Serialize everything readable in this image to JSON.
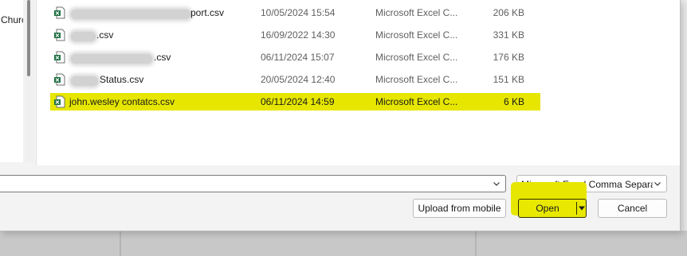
{
  "navigation": {
    "visible_label": "Churc"
  },
  "files": [
    {
      "name_visible": "port.csv",
      "date": "10/05/2024 15:54",
      "type": "Microsoft Excel C...",
      "size": "206 KB",
      "selected": false
    },
    {
      "name_visible": ".csv",
      "date": "16/09/2022 14:30",
      "type": "Microsoft Excel C...",
      "size": "331 KB",
      "selected": false
    },
    {
      "name_visible": ".csv",
      "date": "06/11/2024 15:07",
      "type": "Microsoft Excel C...",
      "size": "176 KB",
      "selected": false
    },
    {
      "name_visible": "Status.csv",
      "date": "20/05/2024 12:40",
      "type": "Microsoft Excel C...",
      "size": "151 KB",
      "selected": false
    },
    {
      "name_visible": "john.wesley contatcs.csv",
      "date": "06/11/2024 14:59",
      "type": "Microsoft Excel C...",
      "size": "6 KB",
      "selected": true
    }
  ],
  "footer": {
    "filename_value": "",
    "filetype_selected": "Microsoft Excel Comma Separa",
    "upload_label": "Upload from mobile",
    "open_label": "Open",
    "cancel_label": "Cancel"
  },
  "colors": {
    "highlight": "#e6e600",
    "excel_green": "#1d6f42",
    "dialog_bg": "#f3f3f3"
  },
  "icons": {
    "file": "excel-csv-icon",
    "dropdown": "chevron-down-icon",
    "split": "caret-down-icon"
  }
}
